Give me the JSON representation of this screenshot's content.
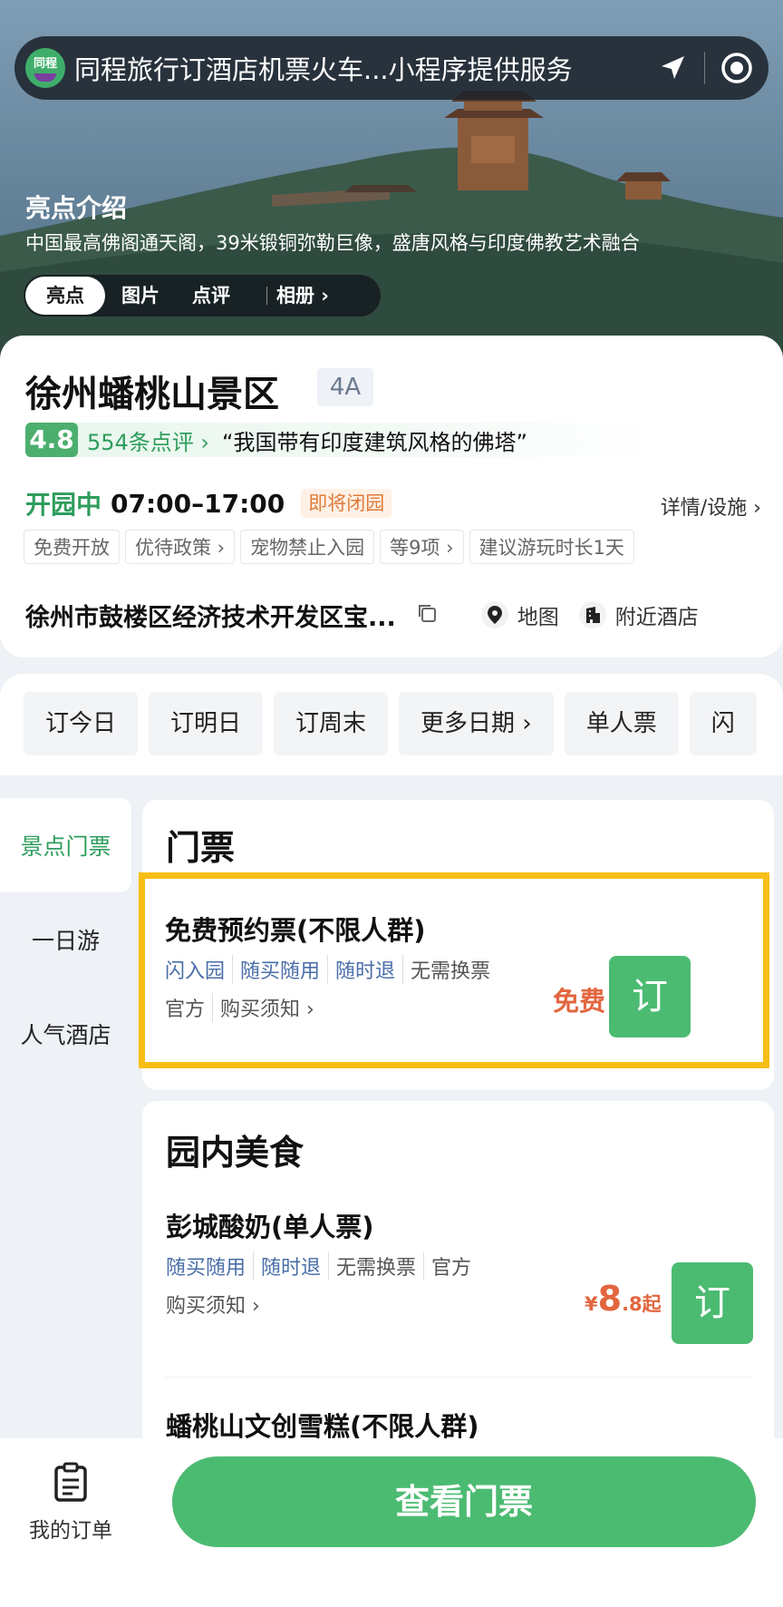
{
  "header": {
    "mini_program_title": "同程旅行订酒店机票火车...小程序提供服务",
    "logo_text": "同程",
    "location_icon": "location-arrow-icon",
    "record_icon": "record-icon"
  },
  "highlight": {
    "title": "亮点介绍",
    "description": "中国最高佛阁通天阁，39米锻铜弥勒巨像，盛唐风格与印度佛教艺术融合",
    "tabs": [
      "亮点",
      "图片",
      "点评"
    ],
    "album_label": "相册 ›"
  },
  "scenic": {
    "name": "徐州蟠桃山景区",
    "grade": "4A",
    "score": "4.8",
    "reviews": "554条点评 ›",
    "quote": "“我国带有印度建筑风格的佛塔”",
    "open_status": "开园中",
    "hours": "07:00–17:00",
    "closing_badge": "即将闭园",
    "details_link": "详情/设施 ›",
    "tags": [
      "免费开放",
      "优待政策 ›",
      "宠物禁止入园",
      "等9项 ›",
      "建议游玩时长1天"
    ],
    "address": "徐州市鼓楼区经济技术开发区宝...",
    "map_label": "地图",
    "nearby_hotel_label": "附近酒店"
  },
  "date_chips": [
    "订今日",
    "订明日",
    "订周末",
    "更多日期 ›",
    "单人票",
    "闪"
  ],
  "left_nav": [
    "景点门票",
    "一日游",
    "人气酒店"
  ],
  "tickets_section": {
    "title": "门票",
    "ticket": {
      "name": "免费预约票(不限人群)",
      "tags_blue": [
        "闪入园",
        "随买随用",
        "随时退"
      ],
      "tags_grey": [
        "无需换票"
      ],
      "tags_row2": [
        "官方",
        "购买须知 ›"
      ],
      "price": "免费",
      "book_label": "订"
    }
  },
  "food_section": {
    "title": "园内美食",
    "item1": {
      "name": "彭城酸奶(单人票)",
      "tags_blue": [
        "随买随用",
        "随时退"
      ],
      "tags_grey": [
        "无需换票",
        "官方"
      ],
      "notice": "购买须知 ›",
      "price_symbol": "¥",
      "price_int": "8",
      "price_dec": ".8起",
      "book_label": "订"
    },
    "item2": {
      "name": "蟠桃山文创雪糕(不限人群)"
    }
  },
  "bottom": {
    "orders_label": "我的订单",
    "view_tickets_label": "查看门票"
  },
  "colors": {
    "brand_green": "#4cbb72",
    "price_orange": "#e2663f",
    "highlight_box": "#f7be16"
  }
}
